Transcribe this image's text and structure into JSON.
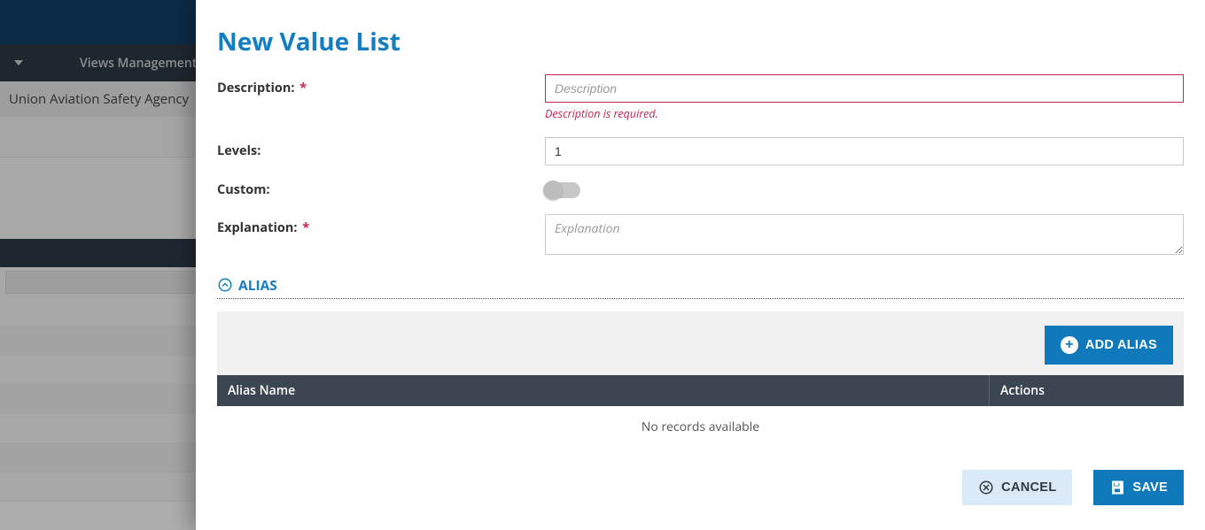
{
  "background": {
    "menubar_item": "Views Management",
    "breadcrumb_fragment": "Union Aviation Safety Agency"
  },
  "panel": {
    "title": "New Value List",
    "fields": {
      "description": {
        "label": "Description:",
        "required_mark": "*",
        "placeholder": "Description",
        "value": "",
        "error": "Description is required."
      },
      "levels": {
        "label": "Levels:",
        "value": "1"
      },
      "custom": {
        "label": "Custom:",
        "on": false
      },
      "explanation": {
        "label": "Explanation:",
        "required_mark": "*",
        "placeholder": "Explanation",
        "value": ""
      }
    },
    "alias_section": {
      "heading": "ALIAS",
      "add_button": "ADD ALIAS",
      "columns": {
        "name": "Alias Name",
        "actions": "Actions"
      },
      "empty_text": "No records available",
      "rows": []
    },
    "footer": {
      "cancel": "CANCEL",
      "save": "SAVE"
    }
  }
}
